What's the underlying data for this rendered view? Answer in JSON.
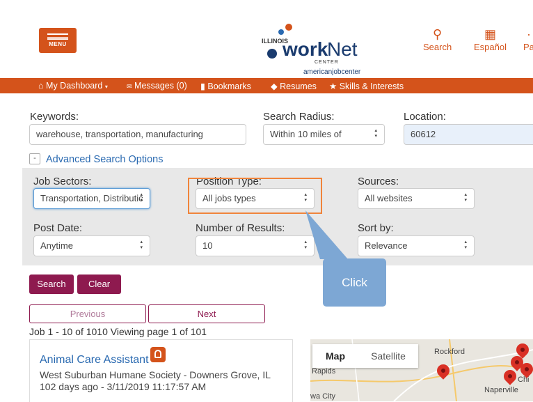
{
  "header": {
    "menu_label": "MENU",
    "logo": {
      "state": "ILLINOIS",
      "work": "work",
      "net": "Net",
      "center": "CENTER",
      "ajc": "americanjobcenter"
    },
    "links": [
      {
        "label": "Search",
        "icon": "search-icon"
      },
      {
        "label": "Español",
        "icon": "translate-icon"
      },
      {
        "label": "Pa",
        "icon": "partial-icon"
      }
    ]
  },
  "nav": {
    "items": [
      {
        "label": "My Dashboard",
        "icon": "home-icon"
      },
      {
        "label": "Messages (0)",
        "icon": "envelope-icon"
      },
      {
        "label": "Bookmarks",
        "icon": "bookmark-icon"
      },
      {
        "label": "Resumes",
        "icon": "resume-icon"
      },
      {
        "label": "Skills & Interests",
        "icon": "star-icon"
      }
    ]
  },
  "search": {
    "keywords_label": "Keywords:",
    "keywords_value": "warehouse, transportation, manufacturing",
    "radius_label": "Search Radius:",
    "radius_value": "Within 10 miles of",
    "location_label": "Location:",
    "location_value": "60612",
    "advanced_toggle": "-",
    "advanced_label": "Advanced Search Options"
  },
  "advanced": {
    "job_sectors_label": "Job Sectors:",
    "job_sectors_value": "Transportation, Distributic",
    "position_type_label": "Position Type:",
    "position_type_value": "All jobs types",
    "sources_label": "Sources:",
    "sources_value": "All websites",
    "post_date_label": "Post Date:",
    "post_date_value": "Anytime",
    "num_results_label": "Number of Results:",
    "num_results_value": "10",
    "sort_label": "Sort by:",
    "sort_value": "Relevance"
  },
  "buttons": {
    "search": "Search",
    "clear": "Clear",
    "previous": "Previous",
    "next": "Next"
  },
  "tooltip": "Click",
  "results": {
    "summary": "Job 1 - 10 of 1010 Viewing page 1 of 101",
    "first": {
      "title": "Animal Care Assistant",
      "employer": "West Suburban Humane Society - Downers Grove, IL",
      "posted": "102 days ago - 3/11/2019 11:17:57 AM"
    }
  },
  "map": {
    "tabs": [
      "Map",
      "Satellite"
    ],
    "places": [
      "Rockford",
      "Rapids",
      "Naperville",
      "Chi",
      "wa City"
    ]
  },
  "colors": {
    "brand_orange": "#d4531b",
    "primary_button": "#8e1a4f",
    "highlight": "#f0843b",
    "tooltip": "#7da7d4"
  }
}
